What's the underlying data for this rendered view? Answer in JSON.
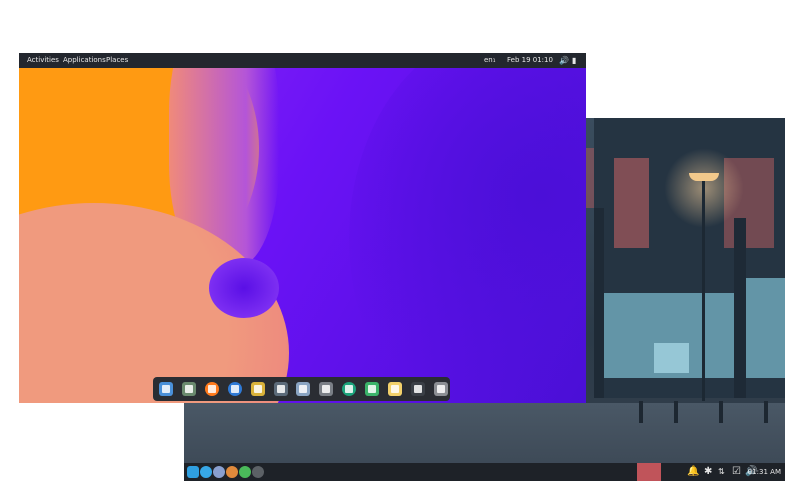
{
  "topbar": {
    "activities": "Activities",
    "applications": "Applications",
    "places": "Places",
    "keyboard_layout": "en₁",
    "datetime": "Feb 19  01:10",
    "icons": [
      "volume-icon",
      "battery-icon"
    ]
  },
  "dock": {
    "apps": [
      {
        "name": "text-editor-icon",
        "color": "#4a90d9"
      },
      {
        "name": "files-icon",
        "color": "#6a8a6e"
      },
      {
        "name": "firefox-icon",
        "color": "#ff7a1c"
      },
      {
        "name": "thunderbird-icon",
        "color": "#2f7ad6"
      },
      {
        "name": "synaptic-icon",
        "color": "#d9b23a"
      },
      {
        "name": "calculator-icon",
        "color": "#5c6b7a"
      },
      {
        "name": "clipboard-icon",
        "color": "#8aa4c2"
      },
      {
        "name": "settings-diamond-icon",
        "color": "#7a7f86"
      },
      {
        "name": "chromium-icon",
        "color": "#1aa37a"
      },
      {
        "name": "installer-icon",
        "color": "#3bb36a"
      },
      {
        "name": "notes-icon",
        "color": "#f2d16b"
      },
      {
        "name": "terminal-icon",
        "color": "#3a3f46"
      },
      {
        "name": "trash-icon",
        "color": "#8c8f94"
      }
    ]
  },
  "back_taskbar": {
    "left_icons": [
      {
        "name": "start-menu-icon",
        "color": "#2f9fe0"
      },
      {
        "name": "browser-icon",
        "color": "#37a7e6"
      },
      {
        "name": "files-icon",
        "color": "#8aa0d0"
      },
      {
        "name": "package-icon",
        "color": "#e08a3c"
      },
      {
        "name": "globe-icon",
        "color": "#4aba5a"
      },
      {
        "name": "terminal-icon",
        "color": "#5c6166"
      }
    ],
    "tray_icons": [
      "bell-icon",
      "bluetooth-icon",
      "network-icon",
      "clipboard-check-icon",
      "volume-icon"
    ],
    "time": "01:31 AM"
  },
  "colors": {
    "accent_orange": "#ff9a12",
    "accent_peach": "#f0907a",
    "accent_purple": "#7b18f6",
    "taskbar_active": "#c0545a"
  }
}
